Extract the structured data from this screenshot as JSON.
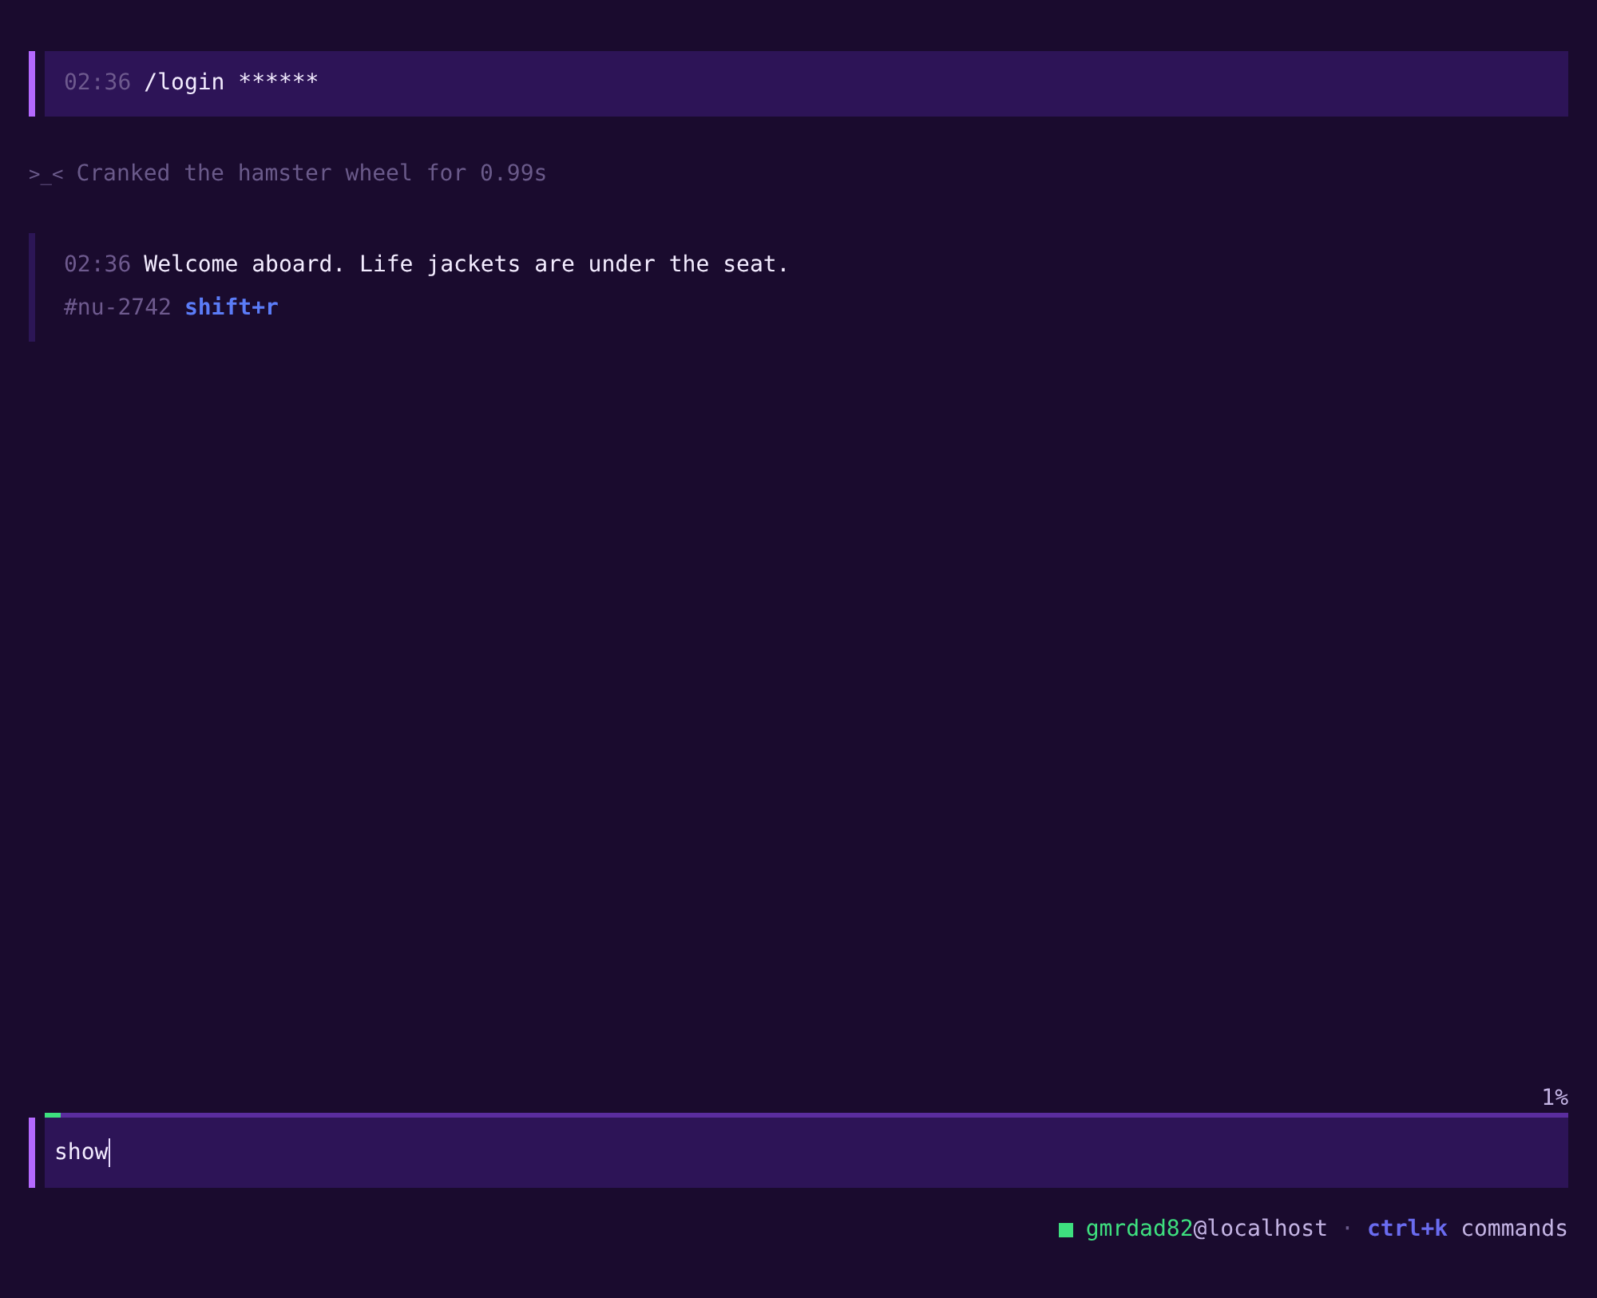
{
  "transcript": [
    {
      "kind": "command",
      "time": "02:36",
      "text": "/login ******"
    },
    {
      "kind": "status",
      "face": ">_<",
      "text": "Cranked the hamster wheel for 0.99s"
    },
    {
      "kind": "reply",
      "time": "02:36",
      "text": "Welcome aboard. Life jackets are under the seat.",
      "ref": "#nu-2742",
      "shortcut": "shift+r"
    }
  ],
  "progress": {
    "level": 0.01,
    "reading": "1%"
  },
  "input": {
    "value": "show"
  },
  "status_bar": {
    "user": "gmrdad82",
    "host": "@localhost",
    "separator": "·",
    "shortcut": "ctrl+k",
    "shortcut_label": "commands"
  }
}
